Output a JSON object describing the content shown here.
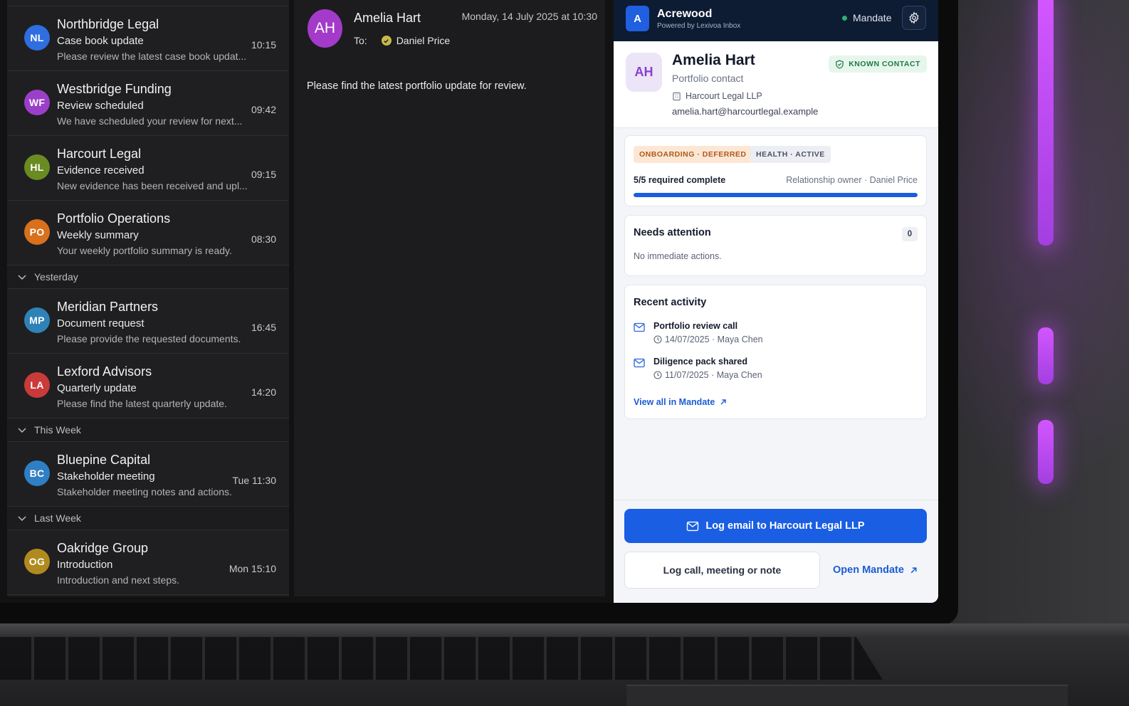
{
  "messages_before": [
    {
      "initials": "NL",
      "color": "#2f6ee0",
      "sender": "Northbridge Legal",
      "subject": "Case book update",
      "preview": "Please review the latest case book updat...",
      "time": "10:15"
    },
    {
      "initials": "WF",
      "color": "#9b3fc9",
      "sender": "Westbridge Funding",
      "subject": "Review scheduled",
      "preview": "We have scheduled your review for next...",
      "time": "09:42"
    },
    {
      "initials": "HL",
      "color": "#6a8a22",
      "sender": "Harcourt Legal",
      "subject": "Evidence received",
      "preview": "New evidence has been received and upl...",
      "time": "09:15"
    },
    {
      "initials": "PO",
      "color": "#d9701c",
      "sender": "Portfolio Operations",
      "subject": "Weekly summary",
      "preview": "Your weekly portfolio summary is ready.",
      "time": "08:30"
    }
  ],
  "groups": {
    "yesterday": "Yesterday",
    "this_week": "This Week",
    "last_week": "Last Week"
  },
  "messages_yesterday": [
    {
      "initials": "MP",
      "color": "#2f82b8",
      "sender": "Meridian Partners",
      "subject": "Document request",
      "preview": "Please provide the requested documents.",
      "time": "16:45"
    },
    {
      "initials": "LA",
      "color": "#c93a3a",
      "sender": "Lexford Advisors",
      "subject": "Quarterly update",
      "preview": "Please find the latest quarterly update.",
      "time": "14:20"
    }
  ],
  "messages_this_week": [
    {
      "initials": "BC",
      "color": "#2f7fc4",
      "sender": "Bluepine Capital",
      "subject": "Stakeholder meeting",
      "preview": "Stakeholder meeting notes and actions.",
      "time": "Tue 11:30"
    }
  ],
  "messages_last_week": [
    {
      "initials": "OG",
      "color": "#b08a1e",
      "sender": "Oakridge Group",
      "subject": "Introduction",
      "preview": "Introduction and next steps.",
      "time": "Mon 15:10"
    }
  ],
  "reader": {
    "initials": "AH",
    "from": "Amelia Hart",
    "date": "Monday, 14 July 2025 at 10:30",
    "to_label": "To:",
    "to_name": "Daniel Price",
    "body": "Please find the latest portfolio update for review."
  },
  "panel": {
    "brand_initial": "A",
    "brand_name": "Acrewood",
    "brand_sub": "Powered by Lexivoa Inbox",
    "mandate_status": "Mandate",
    "contact": {
      "initials": "AH",
      "name": "Amelia Hart",
      "role": "Portfolio contact",
      "org": "Harcourt Legal LLP",
      "email": "amelia.hart@harcourtlegal.example",
      "badge": "KNOWN CONTACT"
    },
    "status": {
      "onboarding": "ONBOARDING · DEFERRED",
      "health": "HEALTH · ACTIVE",
      "progress_label": "5/5 required complete",
      "progress_fraction": 1.0,
      "owner": "Relationship owner · Daniel Price"
    },
    "attention": {
      "title": "Needs attention",
      "count": "0",
      "text": "No immediate actions."
    },
    "activity": {
      "title": "Recent activity",
      "items": [
        {
          "title": "Portfolio review call",
          "meta": "14/07/2025 · Maya Chen"
        },
        {
          "title": "Diligence pack shared",
          "meta": "11/07/2025 · Maya Chen"
        }
      ],
      "view_all": "View all in Mandate"
    },
    "footer": {
      "primary": "Log email to Harcourt Legal LLP",
      "secondary": "Log call, meeting or note",
      "open": "Open Mandate"
    }
  },
  "colors": {
    "accent": "#1a5ee3",
    "panel_header": "#0d1b33",
    "known_green": "#1e7a45"
  }
}
